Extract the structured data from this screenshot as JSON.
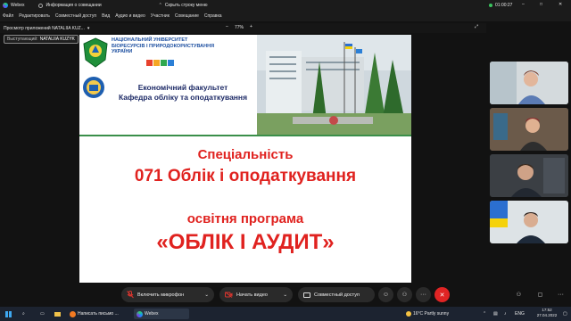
{
  "titlebar": {
    "app_title": "Webex",
    "tab_label": "Информация о совещании",
    "hide_menu": "Скрыть строку меню",
    "time": "01:00:27"
  },
  "menu": {
    "items": [
      "Файл",
      "Редактировать",
      "Совместный доступ",
      "Вид",
      "Аудио и видео",
      "Участник",
      "Совещание",
      "Справка"
    ]
  },
  "viewer": {
    "title": "Просмотр приложений NATALIIA KUZ...",
    "zoom": "77%"
  },
  "speaker": {
    "label": "Выступающий:",
    "name": "NATALIIA KUZYK"
  },
  "slide": {
    "university_line1": "НАЦІОНАЛЬНИЙ УНІВЕРСИТЕТ",
    "university_line2": "БІОРЕСУРСІВ І ПРИРОДОКОРИСТУВАННЯ",
    "university_line3": "УКРАЇНИ",
    "faculty": "Економічний факультет",
    "department": "Кафедра обліку та оподаткування",
    "specialty_label": "Спеціальність",
    "specialty_name": "071 Облік і оподаткування",
    "program_label": "освітня програма",
    "program_name": "«ОБЛІК І АУДИТ»"
  },
  "controls": {
    "mic": "Включить микрофон",
    "video": "Начать видео",
    "share": "Совместный доступ"
  },
  "taskbar": {
    "app1": "Написать письмо ...",
    "app2": "Webex",
    "weather": "16°C  Partly sunny",
    "lang": "ENG",
    "time": "17:52",
    "date": "27.04.2022"
  },
  "colors": {
    "accent_red": "#e0221f",
    "end_call": "#e02424",
    "mic_red": "#d9352e"
  }
}
